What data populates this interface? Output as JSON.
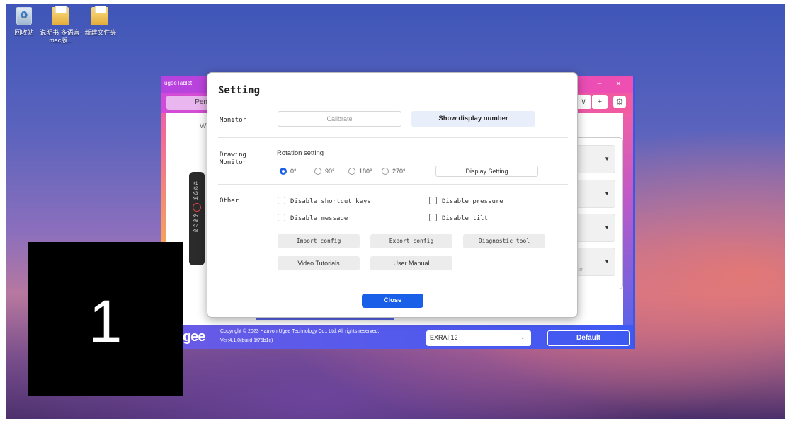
{
  "desktop": {
    "icons": [
      {
        "label": "回收站",
        "icon": "recycle-bin-icon"
      },
      {
        "label": "说明书 多语言-mac版...",
        "icon": "folder-icon"
      },
      {
        "label": "新建文件夹",
        "icon": "folder-icon"
      }
    ]
  },
  "app": {
    "title": "ugeeTablet",
    "tab_pen": "Pen",
    "w_text": "W",
    "device_keys": [
      "K1",
      "K2",
      "K3",
      "K4",
      "K5",
      "K6",
      "K7",
      "K8"
    ],
    "window_controls": {
      "minimize": "−",
      "close": "×"
    },
    "combo_caret": "∨",
    "add": "+",
    "gear": "⚙",
    "panel_item_hint": "ion",
    "logo": "gee",
    "copyright": "Copyright © 2023 Hanvon Ugee Technology Co., Ltd. All rights reserved.",
    "version": "Ver:4.1.0(build 1f75b1c)",
    "device_select": "EXRAI 12",
    "default_label": "Default"
  },
  "dialog": {
    "title": "Setting",
    "monitor": {
      "label": "Monitor",
      "calibrate": "Calibrate",
      "show_display_number": "Show display number"
    },
    "drawing_monitor": {
      "label_line1": "Drawing",
      "label_line2": "Monitor",
      "rotation_label": "Rotation setting",
      "rotations": [
        "0°",
        "90°",
        "180°",
        "270°"
      ],
      "selected_rotation": "0°",
      "display_setting": "Display Setting"
    },
    "other": {
      "label": "Other",
      "disable_shortcut_keys": "Disable shortcut keys",
      "disable_pressure": "Disable pressure",
      "disable_message": "Disable message",
      "disable_tilt": "Disable tilt",
      "import_config": "Import config",
      "export_config": "Export config",
      "diagnostic_tool": "Diagnostic tool",
      "video_tutorials": "Video Tutorials",
      "user_manual": "User Manual"
    },
    "close": "Close"
  },
  "overlay": {
    "number": "1"
  }
}
